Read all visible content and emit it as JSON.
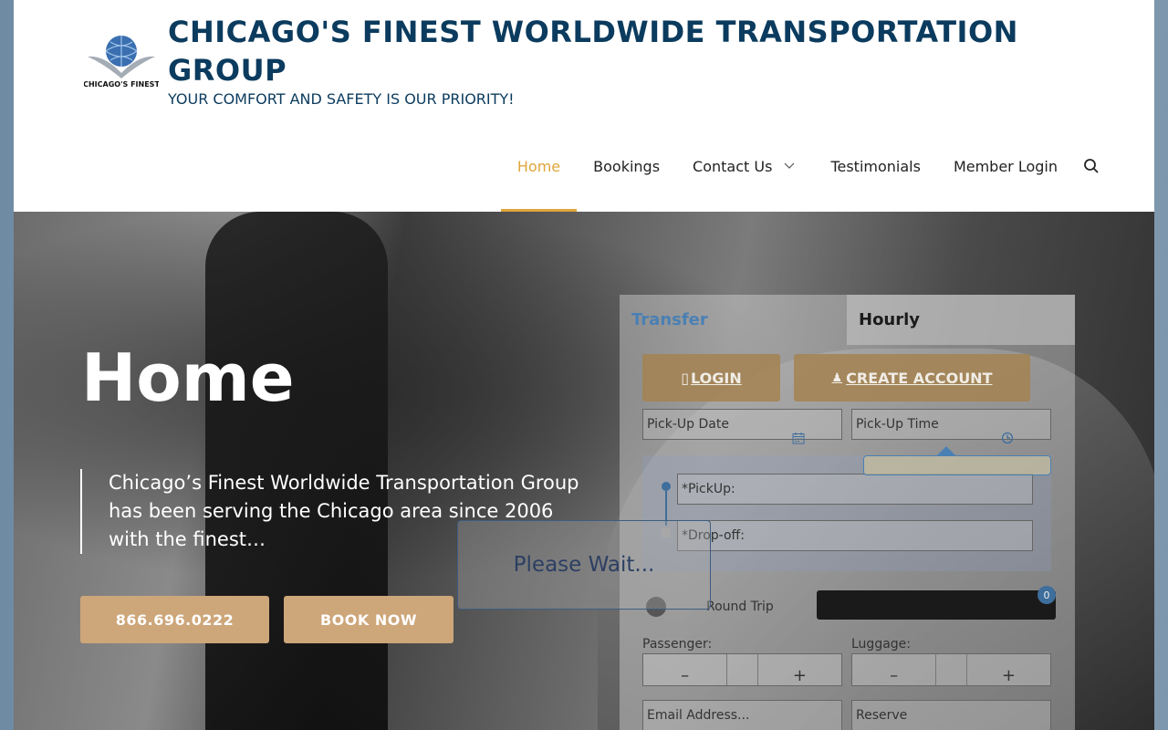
{
  "site": {
    "title": "CHICAGO'S FINEST WORLDWIDE TRANSPORTATION GROUP",
    "tagline": "YOUR COMFORT AND SAFETY IS OUR PRIORITY!",
    "logo_text": "CHICAGO'S FINEST"
  },
  "nav": {
    "items": [
      "Home",
      "Bookings",
      "Contact Us",
      "Testimonials",
      "Member Login"
    ],
    "active": "Home"
  },
  "hero": {
    "title": "Home",
    "text": "Chicago’s Finest Worldwide Transportation Group has been serving the Chicago area since 2006 with the finest…",
    "phone_button": "866.696.0222",
    "book_button": "BOOK NOW"
  },
  "booking": {
    "tabs": [
      "Transfer",
      "Hourly"
    ],
    "login_label": "LOGIN",
    "create_account_label": "CREATE ACCOUNT",
    "pickup_date_placeholder": "Pick-Up Date",
    "pickup_time_placeholder": "Pick-Up Time",
    "pickup_placeholder": "*PickUp:",
    "dropoff_placeholder": "*Drop-off:",
    "round_trip_label": "Round Trip",
    "vehicle_badge": "0",
    "passenger_label": "Passenger:",
    "luggage_label": "Luggage:",
    "minus": "–",
    "plus": "+",
    "email_placeholder": "Email Address...",
    "reserve_label": "Reserve"
  },
  "overlay": {
    "please_wait": "Please Wait..."
  },
  "colors": {
    "title_blue": "#0b3b5e",
    "accent_gold": "#e0a53c",
    "button_tan": "#cda67a",
    "tab_blue": "#4a80b4"
  }
}
